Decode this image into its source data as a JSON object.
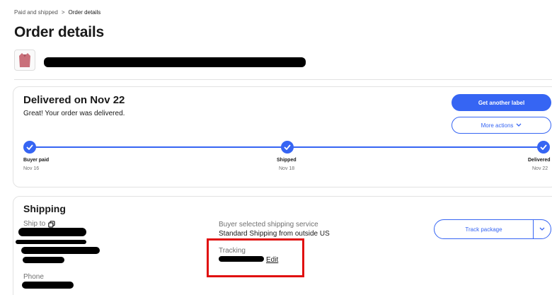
{
  "breadcrumb": {
    "parent": "Paid and shipped",
    "separator": ">",
    "current": "Order details"
  },
  "page": {
    "title": "Order details"
  },
  "status": {
    "title": "Delivered on Nov 22",
    "subtitle": "Great! Your order was delivered.",
    "primary_button": "Get another label",
    "secondary_button": "More actions",
    "steps": [
      {
        "label": "Buyer paid",
        "date": "Nov 16"
      },
      {
        "label": "Shipped",
        "date": "Nov 18"
      },
      {
        "label": "Delivered",
        "date": "Nov 22"
      }
    ],
    "accent_color": "#3665f3"
  },
  "shipping": {
    "title": "Shipping",
    "ship_to_label": "Ship to",
    "phone_label": "Phone",
    "service_label": "Buyer selected shipping service",
    "service_value": "Standard Shipping from outside US",
    "tracking_label": "Tracking",
    "edit_label": "Edit",
    "track_button": "Track package"
  },
  "highlight_color": "#e0100f"
}
